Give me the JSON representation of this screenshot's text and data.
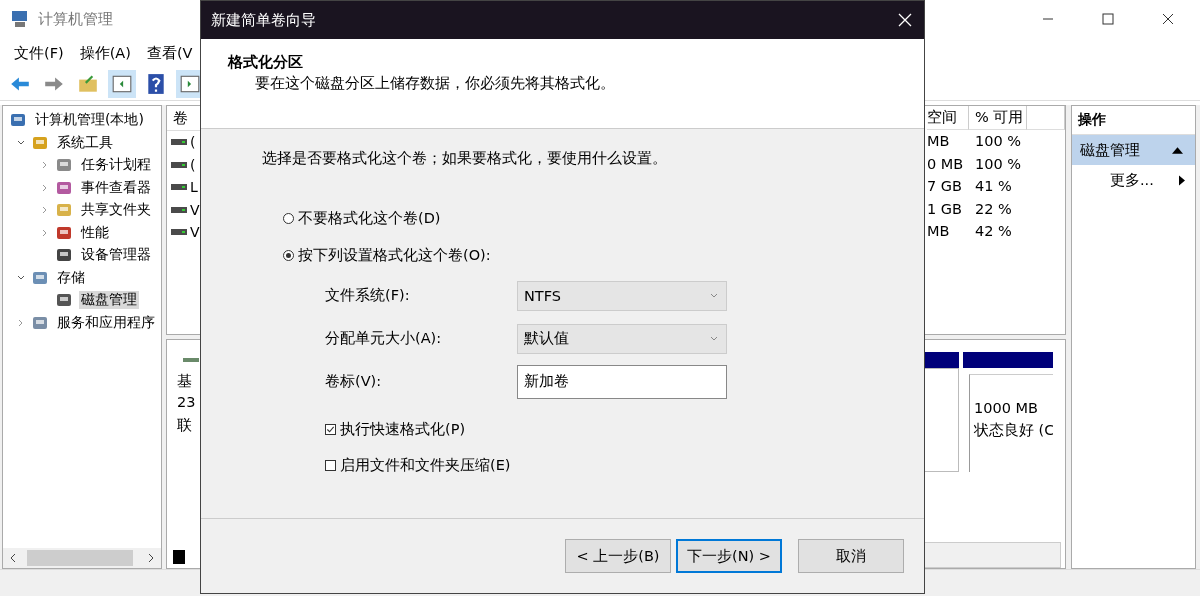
{
  "window": {
    "title": "计算机管理"
  },
  "menu": [
    {
      "label": "文件(F)"
    },
    {
      "label": "操作(A)"
    },
    {
      "label": "查看(V"
    }
  ],
  "tree": [
    {
      "label": "计算机管理(本地)",
      "selected": false,
      "children": [
        {
          "label": "系统工具",
          "expanded": true,
          "selected": false,
          "children": [
            {
              "label": "任务计划程",
              "expanded": false,
              "selected": false
            },
            {
              "label": "事件查看器",
              "expanded": false,
              "selected": false
            },
            {
              "label": "共享文件夹",
              "expanded": false,
              "selected": false
            },
            {
              "label": "性能",
              "expanded": false,
              "selected": false
            },
            {
              "label": "设备管理器",
              "selected": false
            }
          ]
        },
        {
          "label": "存储",
          "expanded": true,
          "selected": false,
          "children": [
            {
              "label": "磁盘管理",
              "selected": true
            }
          ]
        },
        {
          "label": "服务和应用程序",
          "expanded": false,
          "selected": false
        }
      ]
    }
  ],
  "volume_list": {
    "column_1": "卷",
    "rows": [
      {
        "column_1": "("
      },
      {
        "column_1": "("
      },
      {
        "column_1": "L"
      },
      {
        "column_1": "V"
      },
      {
        "column_1": "V"
      }
    ],
    "columns": [
      "空间",
      "% 可用"
    ],
    "cells": [
      [
        "MB",
        "100 %"
      ],
      [
        "0 MB",
        "100 %"
      ],
      [
        "7 GB",
        "41 %"
      ],
      [
        "1 GB",
        "22 %"
      ],
      [
        "MB",
        "42 %"
      ]
    ]
  },
  "disk_map": {
    "disk_label": [
      "基",
      "23",
      "联"
    ],
    "partition": [
      "1000 MB",
      "状态良好 (C"
    ]
  },
  "actions": {
    "title": "操作",
    "section": "磁盘管理",
    "items": [
      "更多..."
    ]
  },
  "dialog": {
    "title": "新建简单卷向导",
    "heading": "格式化分区",
    "subheading": "要在这个磁盘分区上储存数据，你必须先将其格式化。",
    "prompt": "选择是否要格式化这个卷；如果要格式化，要使用什么设置。",
    "options": [
      {
        "label": "不要格式化这个卷(D)",
        "selected": false
      },
      {
        "label": "按下列设置格式化这个卷(O):",
        "selected": true
      }
    ],
    "fields": [
      {
        "label": "文件系统(F):",
        "kind": "dropdown",
        "value": "NTFS"
      },
      {
        "label": "分配单元大小(A):",
        "kind": "dropdown",
        "value": "默认值"
      },
      {
        "label": "卷标(V):",
        "kind": "text",
        "value": "新加卷"
      }
    ],
    "checkboxes": [
      {
        "label": "执行快速格式化(P)",
        "checked": true
      },
      {
        "label": "启用文件和文件夹压缩(E)",
        "checked": false
      }
    ],
    "buttons": [
      {
        "label": "< 上一步(B)",
        "kind": "normal"
      },
      {
        "label": "下一步(N) >",
        "kind": "default"
      },
      {
        "label": "取消",
        "kind": "normal"
      }
    ]
  }
}
